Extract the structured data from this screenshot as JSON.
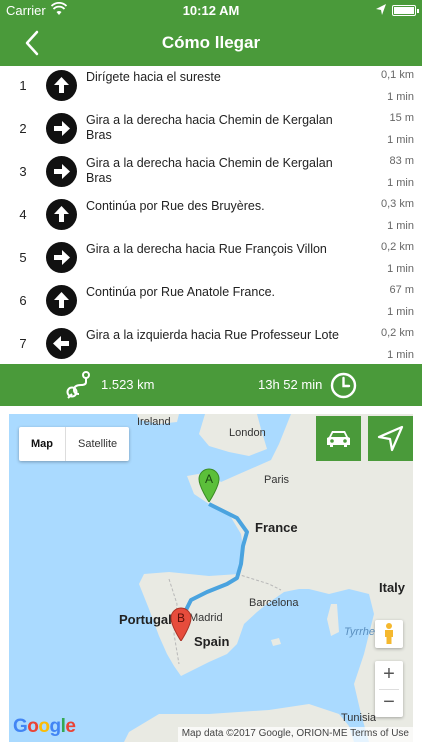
{
  "status_bar": {
    "carrier": "Carrier",
    "time": "10:12 AM",
    "wifi_icon": "wifi-icon",
    "battery_icon": "battery-icon"
  },
  "nav": {
    "title": "Cómo llegar",
    "back_icon": "chevron-left-icon"
  },
  "steps": [
    {
      "number": "1",
      "icon": "arrow-up-icon",
      "text": "Dirígete hacia el sureste",
      "distance": "0,1 km",
      "duration": "1 min"
    },
    {
      "number": "2",
      "icon": "arrow-right-icon",
      "text": "Gira a la derecha hacia Chemin de Kergalan Bras",
      "distance": "15 m",
      "duration": "1 min"
    },
    {
      "number": "3",
      "icon": "arrow-right-icon",
      "text": "Gira a la derecha hacia Chemin de Kergalan Bras",
      "distance": "83 m",
      "duration": "1 min"
    },
    {
      "number": "4",
      "icon": "arrow-up-icon",
      "text": "Continúa por Rue des Bruyères.",
      "distance": "0,3 km",
      "duration": "1 min"
    },
    {
      "number": "5",
      "icon": "arrow-right-icon",
      "text": "Gira a la derecha hacia Rue François Villon",
      "distance": "0,2 km",
      "duration": "1 min"
    },
    {
      "number": "6",
      "icon": "arrow-up-icon",
      "text": "Continúa por Rue Anatole France.",
      "distance": "67 m",
      "duration": "1 min"
    },
    {
      "number": "7",
      "icon": "arrow-left-icon",
      "text": "Gira a la izquierda hacia Rue Professeur Lote",
      "distance": "0,2 km",
      "duration": "1 min"
    }
  ],
  "summary": {
    "distance": "1.523 km",
    "duration": "13h 52 min"
  },
  "map": {
    "type_map": "Map",
    "type_satellite": "Satellite",
    "marker_a": "A",
    "marker_b": "B",
    "zoom_in": "+",
    "zoom_out": "−",
    "logo": "Google",
    "attribution": "Map data ©2017 Google, ORION-ME    Terms of Use",
    "labels": {
      "ireland": "Ireland",
      "london": "London",
      "paris": "Paris",
      "france": "France",
      "italy": "Italy",
      "madrid": "Madrid",
      "barcelona": "Barcelona",
      "spain": "Spain",
      "portugal": "Portugal",
      "tyrrhenian": "Tyrrhe",
      "tunisia": "Tunisia"
    },
    "accent_color": "#4a9a3a",
    "route_color": "#4aa3df"
  }
}
